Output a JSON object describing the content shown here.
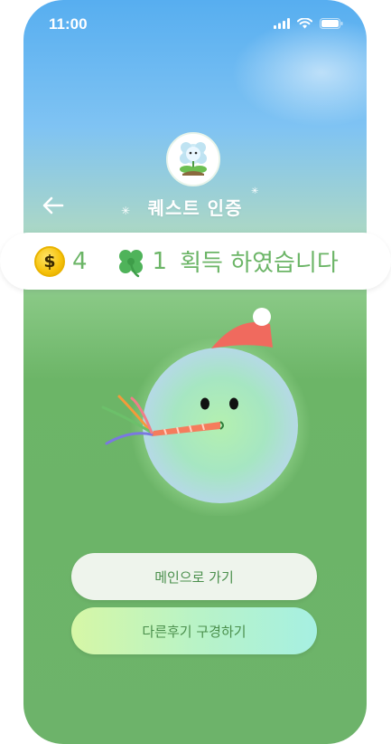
{
  "status_bar": {
    "time": "11:00",
    "icons": [
      "signal-icon",
      "wifi-icon",
      "battery-icon"
    ]
  },
  "nav": {
    "title": "퀘스트 인증",
    "back_icon": "arrow-left-icon"
  },
  "reward": {
    "coin_symbol": "$",
    "coin_count": "4",
    "clover_count": "1",
    "message": "획득 하였습니다"
  },
  "buttons": {
    "main_label": "메인으로 가기",
    "reviews_label": "다른후기 구경하기"
  },
  "colors": {
    "accent_green": "#6cb567",
    "sky_blue": "#57aef0",
    "coin_gold": "#f6c20a"
  }
}
